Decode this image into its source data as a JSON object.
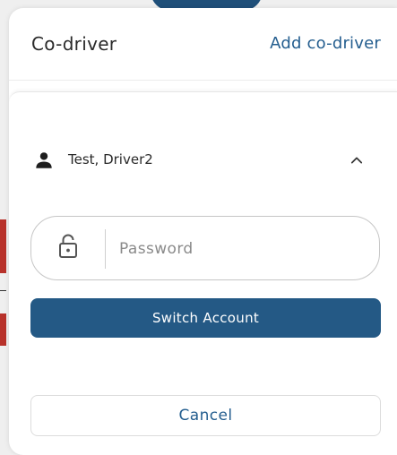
{
  "dialog": {
    "title": "Co-driver",
    "add_link_label": "Add co-driver"
  },
  "driver": {
    "name": "Test, Driver2",
    "icon": "person-icon",
    "expand_icon": "chevron-up-icon"
  },
  "password": {
    "placeholder": "Password",
    "value": "",
    "icon": "unlocked-padlock-icon"
  },
  "actions": {
    "switch_label": "Switch Account",
    "cancel_label": "Cancel"
  },
  "colors": {
    "primary": "#245985",
    "link": "#245e8f"
  }
}
